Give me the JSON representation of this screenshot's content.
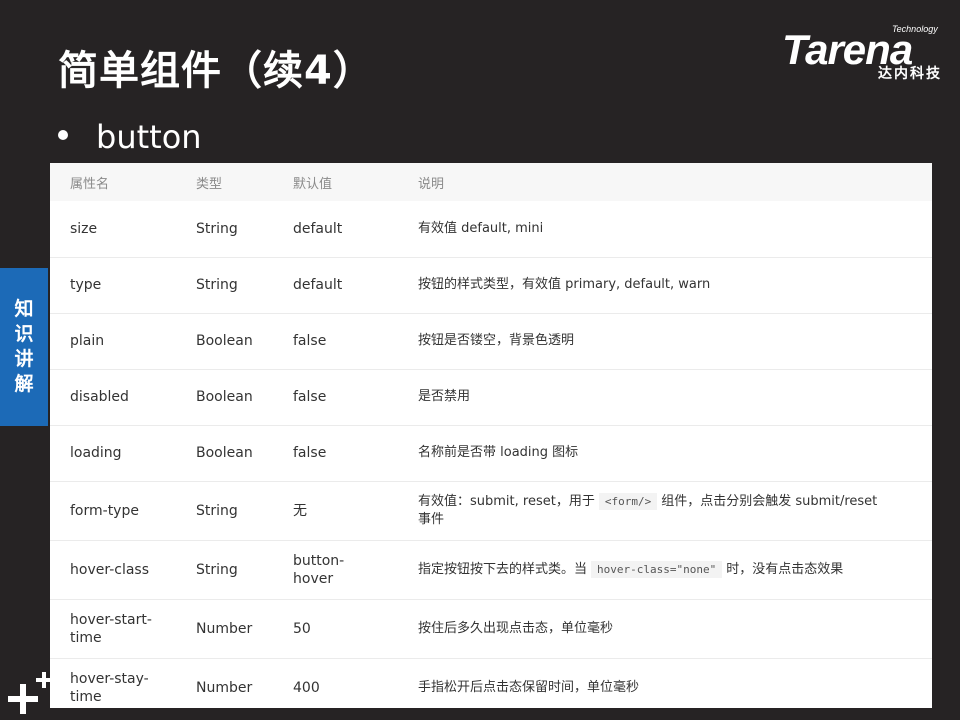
{
  "slide": {
    "title": "简单组件（续4）",
    "bullet": "button",
    "side_tab": [
      "知",
      "识",
      "讲",
      "解"
    ]
  },
  "logo": {
    "small": "Technology",
    "brand": "Tarena",
    "cn": "达内科技"
  },
  "table": {
    "headers": [
      "属性名",
      "类型",
      "默认值",
      "说明"
    ],
    "rows": [
      {
        "name": "size",
        "type": "String",
        "default": "default",
        "desc": "有效值 default, mini"
      },
      {
        "name": "type",
        "type": "String",
        "default": "default",
        "desc": "按钮的样式类型，有效值 primary, default, warn"
      },
      {
        "name": "plain",
        "type": "Boolean",
        "default": "false",
        "desc": "按钮是否镂空，背景色透明"
      },
      {
        "name": "disabled",
        "type": "Boolean",
        "default": "false",
        "desc": "是否禁用"
      },
      {
        "name": "loading",
        "type": "Boolean",
        "default": "false",
        "desc": "名称前是否带 loading 图标"
      },
      {
        "name": "form-type",
        "type": "String",
        "default": "无",
        "desc_a": "有效值：submit, reset，用于",
        "desc_code": "<form/>",
        "desc_b": "组件，点击分别会触发 submit/reset",
        "desc_c": "事件"
      },
      {
        "name": "hover-class",
        "type": "String",
        "default_a": "button-",
        "default_b": "hover",
        "desc_a": "指定按钮按下去的样式类。当",
        "desc_code": "hover-class=\"none\"",
        "desc_b": "时，没有点击态效果"
      },
      {
        "name_a": "hover-start-",
        "name_b": "time",
        "type": "Number",
        "default": "50",
        "desc": "按住后多久出现点击态，单位毫秒"
      },
      {
        "name_a": "hover-stay-",
        "name_b": "time",
        "type": "Number",
        "default": "400",
        "desc": "手指松开后点击态保留时间，单位毫秒"
      }
    ]
  }
}
